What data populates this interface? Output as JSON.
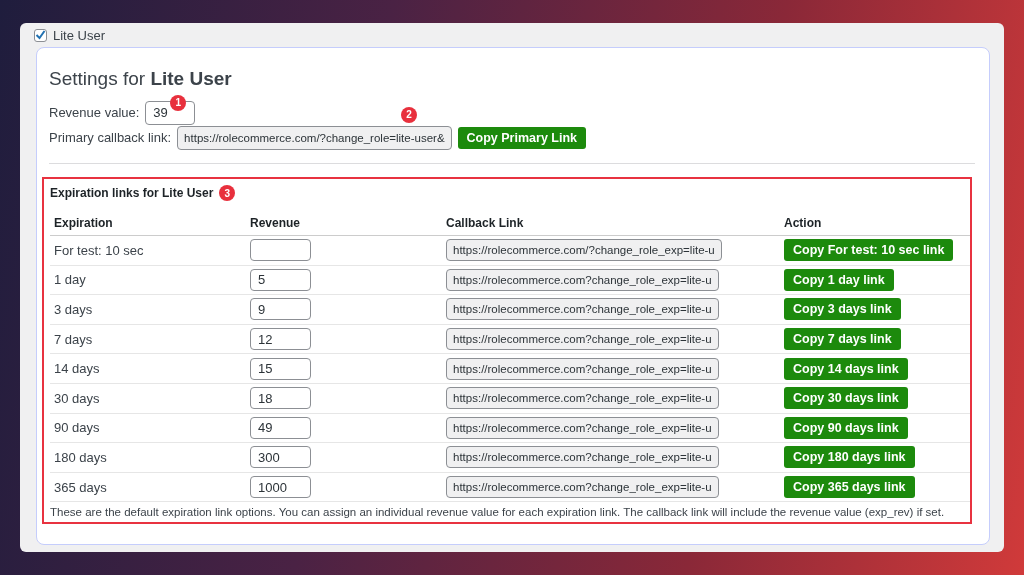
{
  "role": {
    "label": "Lite User",
    "checked": true
  },
  "settings": {
    "title_prefix": "Settings for",
    "title_role": "Lite User",
    "revenue": {
      "label": "Revenue value:",
      "value": "39",
      "callout": "1"
    },
    "primary": {
      "label": "Primary callback link:",
      "value": "https://rolecommerce.com/?change_role=lite-user&",
      "button": "Copy Primary Link",
      "callout": "2"
    }
  },
  "expiration": {
    "title": "Expiration links for Lite User",
    "callout": "3",
    "columns": [
      "Expiration",
      "Revenue",
      "Callback Link",
      "Action"
    ],
    "rows": [
      {
        "expiration": "For test: 10 sec",
        "link": "https://rolecommerce.com/?change_role_exp=lite-u",
        "button": "Copy For test: 10 sec link"
      },
      {
        "expiration": "1 day",
        "revenue": "5",
        "link": "https://rolecommerce.com?change_role_exp=lite-u",
        "button": "Copy 1 day link"
      },
      {
        "expiration": "3 days",
        "revenue": "9",
        "link": "https://rolecommerce.com?change_role_exp=lite-u",
        "button": "Copy 3 days link"
      },
      {
        "expiration": "7 days",
        "revenue": "12",
        "link": "https://rolecommerce.com?change_role_exp=lite-u",
        "button": "Copy 7 days link"
      },
      {
        "expiration": "14 days",
        "revenue": "15",
        "link": "https://rolecommerce.com?change_role_exp=lite-u",
        "button": "Copy 14 days link"
      },
      {
        "expiration": "30 days",
        "revenue": "18",
        "link": "https://rolecommerce.com?change_role_exp=lite-u",
        "button": "Copy 30 days link"
      },
      {
        "expiration": "90 days",
        "revenue": "49",
        "link": "https://rolecommerce.com?change_role_exp=lite-u",
        "button": "Copy 90 days link"
      },
      {
        "expiration": "180 days",
        "revenue": "300",
        "link": "https://rolecommerce.com?change_role_exp=lite-u",
        "button": "Copy 180 days link"
      },
      {
        "expiration": "365 days",
        "revenue": "1000",
        "link": "https://rolecommerce.com?change_role_exp=lite-u",
        "button": "Copy 365 days link"
      }
    ],
    "note": "These are the default expiration link options. You can assign an individual revenue value for each expiration link. The callback link will include the revenue value (exp_rev) if set."
  }
}
